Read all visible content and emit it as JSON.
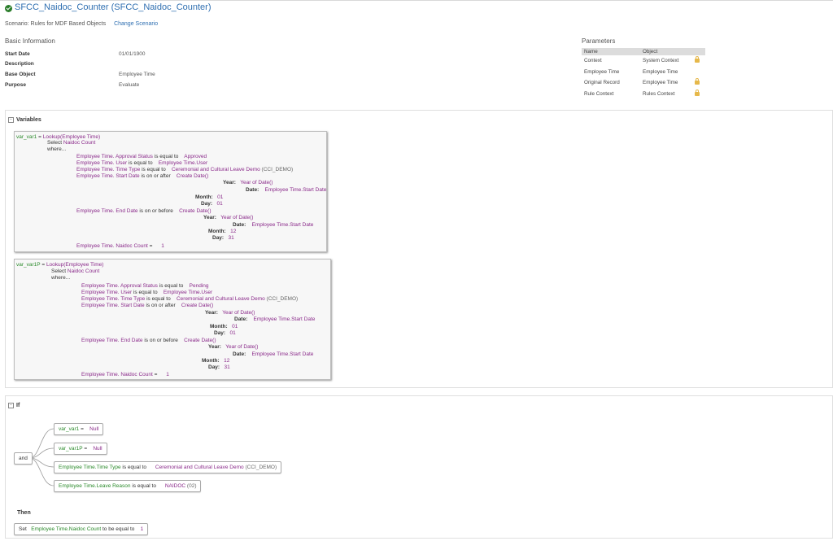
{
  "header": {
    "title": "SFCC_Naidoc_Counter (SFCC_Naidoc_Counter)",
    "scenario_label": "Scenario: Rules for MDF Based Objects",
    "change_scenario": "Change Scenario"
  },
  "basic": {
    "title": "Basic Information",
    "fields": [
      {
        "label": "Start Date",
        "value": "01/01/1900"
      },
      {
        "label": "Description",
        "value": ""
      },
      {
        "label": "Base Object",
        "value": "Employee Time"
      },
      {
        "label": "Purpose",
        "value": "Evaluate"
      }
    ]
  },
  "parameters": {
    "title": "Parameters",
    "columns": [
      "Name",
      "Object"
    ],
    "rows": [
      {
        "name": "Context",
        "object": "System Context",
        "locked": true
      },
      {
        "name": "Employee Time",
        "object": "Employee Time",
        "locked": false
      },
      {
        "name": "Original Record",
        "object": "Employee Time",
        "locked": true
      },
      {
        "name": "Rule Context",
        "object": "Rules Context",
        "locked": true
      }
    ]
  },
  "variables": {
    "title": "Variables",
    "var1": {
      "name": "var_var1",
      "eq": "=",
      "lookup": "Lookup(Employee Time)",
      "select_kw": "Select",
      "select_field": "Naidoc Count",
      "where": "where...",
      "c1_field": "Employee Time. Approval Status",
      "c1_op": "is equal to",
      "c1_val": "Approved",
      "c2_field": "Employee Time. User",
      "c2_op": "is equal to",
      "c2_val": "Employee Time.User",
      "c3_field": "Employee Time. Time Type",
      "c3_op": "is equal to",
      "c3_val": "Ceremonial and Cultural Leave Demo",
      "c3_code": "(CCI_DEMO)",
      "c4_field": "Employee Time. Start Date",
      "c4_op": "is on or after",
      "c4_val": "Create Date()",
      "year_lbl": "Year:",
      "year_fn": "Year of Date()",
      "date_lbl": "Date:",
      "date_val": "Employee Time.Start Date",
      "month_lbl": "Month:",
      "month_a": "01",
      "day_lbl": "Day:",
      "day_a": "01",
      "c5_field": "Employee Time. End Date",
      "c5_op": "is on or before",
      "c5_val": "Create Date()",
      "month_b": "12",
      "day_b": "31",
      "c6_field": "Employee Time. Naidoc Count",
      "c6_op": "=",
      "c6_val": "1"
    },
    "var2": {
      "name": "var_var1P",
      "eq": "=",
      "lookup": "Lookup(Employee Time)",
      "select_kw": "Select",
      "select_field": "Naidoc Count",
      "where": "where...",
      "c1_field": "Employee Time. Approval Status",
      "c1_op": "is equal to",
      "c1_val": "Pending",
      "c2_field": "Employee Time. User",
      "c2_op": "is equal to",
      "c2_val": "Employee Time.User",
      "c3_field": "Employee Time. Time Type",
      "c3_op": "is equal to",
      "c3_val": "Ceremonial and Cultural Leave Demo",
      "c3_code": "(CCI_DEMO)",
      "c4_field": "Employee Time. Start Date",
      "c4_op": "is on or after",
      "c4_val": "Create Date()",
      "year_lbl": "Year:",
      "year_fn": "Year of Date()",
      "date_lbl": "Date:",
      "date_val": "Employee Time.Start Date",
      "month_lbl": "Month:",
      "month_a": "01",
      "day_lbl": "Day:",
      "day_a": "01",
      "c5_field": "Employee Time. End Date",
      "c5_op": "is on or before",
      "c5_val": "Create Date()",
      "month_b": "12",
      "day_b": "31",
      "c6_field": "Employee Time. Naidoc Count",
      "c6_op": "=",
      "c6_val": "1"
    }
  },
  "if_section": {
    "title": "If",
    "operator": "and",
    "cond1": {
      "field": "var_var1",
      "op": "=",
      "val": "Null"
    },
    "cond2": {
      "field": "var_var1P",
      "op": "=",
      "val": "Null"
    },
    "cond3": {
      "field": "Employee Time.Time Type",
      "op": "is equal to",
      "val": "Ceremonial and Cultural Leave Demo",
      "code": "(CCI_DEMO)"
    },
    "cond4": {
      "field": "Employee Time.Leave Reason",
      "op": "is equal to",
      "val": "NAIDOC",
      "code": "(02)"
    }
  },
  "then_section": {
    "title": "Then",
    "set_kw": "Set",
    "field": "Employee Time.Naidoc Count",
    "op": "to be equal to",
    "val": "1"
  },
  "colors": {
    "link": "#2f6fb1",
    "field_green": "#2a8a2a",
    "value_purple": "#8a2a8a",
    "check_green": "#2b7d2b",
    "lock": "#e6b84a"
  },
  "icons": [
    "check-circle-icon",
    "lock-icon",
    "expand-collapse-icon"
  ]
}
